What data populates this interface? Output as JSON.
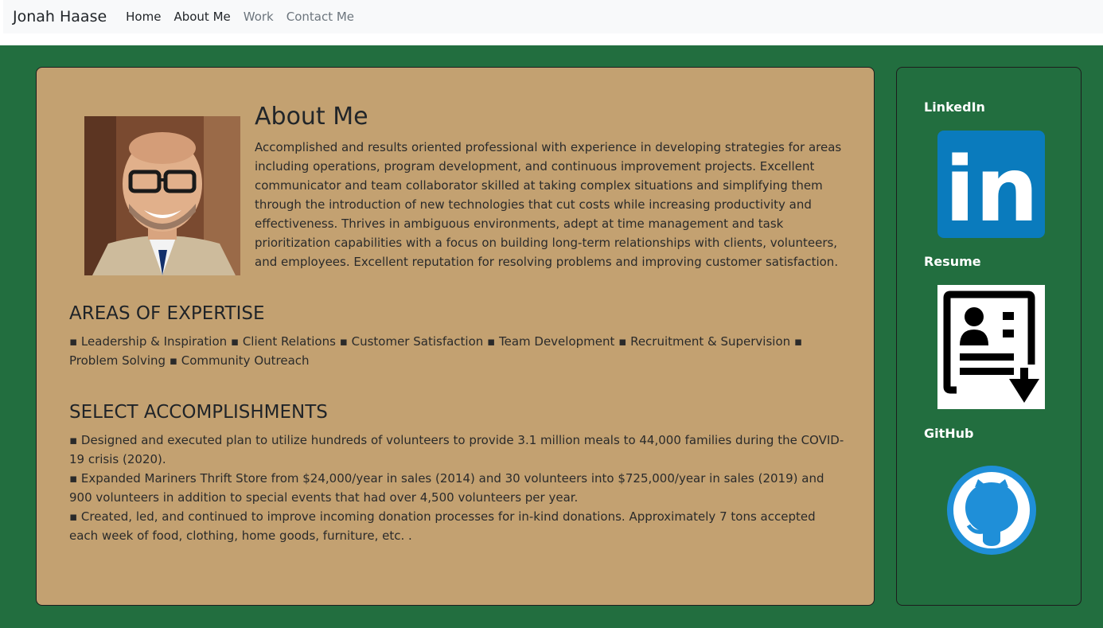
{
  "nav": {
    "brand": "Jonah Haase",
    "links": [
      "Home",
      "About Me",
      "Work",
      "Contact Me"
    ]
  },
  "about": {
    "title": "About Me",
    "text": "Accomplished and results oriented professional with experience in developing strategies for areas including operations, program development, and continuous improvement projects. Excellent communicator and team collaborator skilled at taking complex situations and simplifying them through the introduction of new technologies that cut costs while increasing productivity and effectiveness. Thrives in ambiguous environments, adept at time management and task prioritization capabilities with a focus on building long-term relationships with clients, volunteers, and employees. Excellent reputation for resolving problems and improving customer satisfaction."
  },
  "expertise": {
    "title": "AREAS OF EXPERTISE",
    "text": "▪ Leadership & Inspiration ▪ Client Relations ▪ Customer Satisfaction ▪ Team Development ▪ Recruitment & Supervision ▪ Problem Solving ▪ Community Outreach"
  },
  "accomplishments": {
    "title": "SELECT ACCOMPLISHMENTS",
    "items": [
      "▪ Designed and executed plan to utilize hundreds of volunteers to provide 3.1 million meals to 44,000 families during the COVID-19 crisis (2020).",
      "▪ Expanded Mariners Thrift Store from $24,000/year in sales (2014) and 30 volunteers into $725,000/year in sales (2019) and 900 volunteers in addition to special events that had over 4,500 volunteers per year.",
      "▪ Created, led, and continued to improve incoming donation processes for in-kind donations. Approximately 7 tons accepted each week of food, clothing, home goods, furniture, etc. ."
    ]
  },
  "sidebar": {
    "linkedin_label": "LinkedIn",
    "linkedin_logo_text": "in",
    "resume_label": "Resume",
    "github_label": "GitHub"
  },
  "colors": {
    "page_green": "#226e3f",
    "card_tan": "#c3a171",
    "linkedin_blue": "#0a7bbd",
    "github_blue": "#1f8fd8"
  }
}
